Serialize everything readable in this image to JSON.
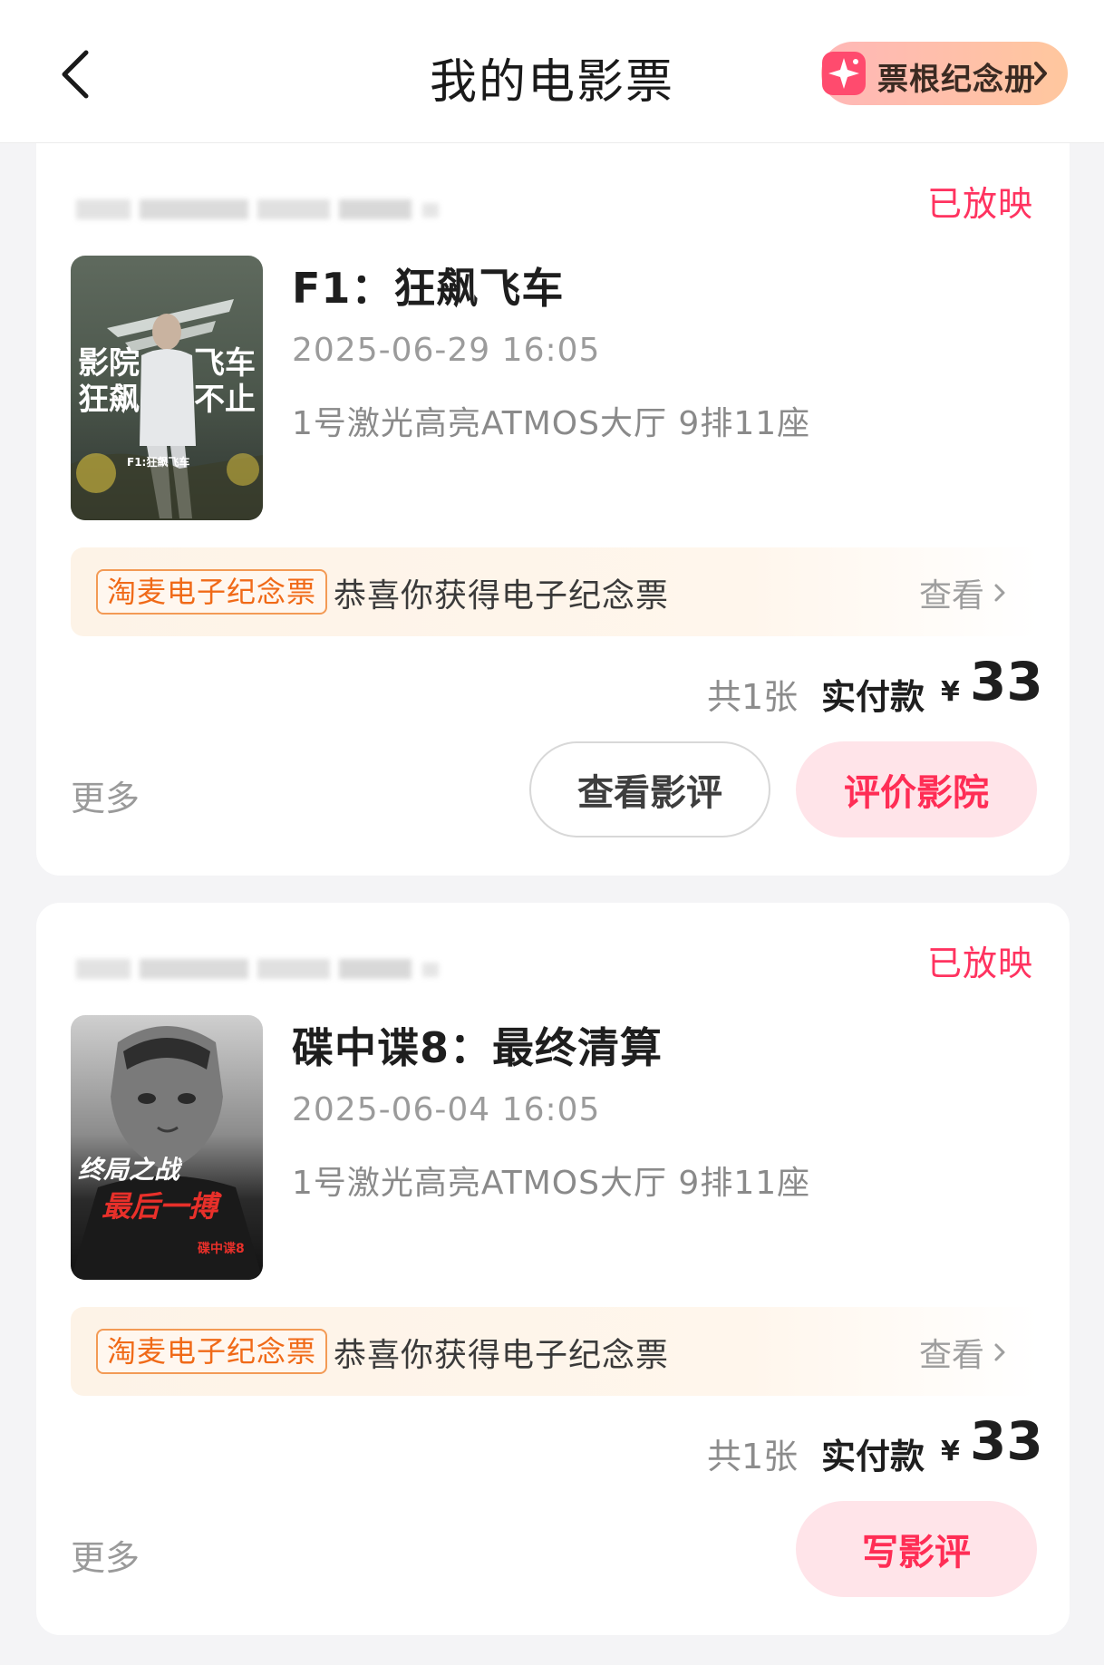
{
  "header": {
    "title": "我的电影票",
    "album_label": "票根纪念册"
  },
  "orders": [
    {
      "status": "已放映",
      "movie_title": "F1：狂飙飞车",
      "show_time": "2025-06-29 16:05",
      "seat": "1号激光高亮ATMOS大厅 9排11座",
      "souvenir_tag": "淘麦电子纪念票",
      "souvenir_text": "恭喜你获得电子纪念票",
      "souvenir_view": "查看",
      "total_count": "共1张",
      "paid_label": "实付款",
      "currency": "¥",
      "price": "33",
      "more": "更多",
      "btn_secondary": "查看影评",
      "btn_primary": "评价影院",
      "poster_text": {
        "brand": "F1",
        "line_left_1": "影院",
        "line_left_2": "狂飙",
        "line_right_1": "飞车",
        "line_right_2": "不止",
        "caption": "F1:狂飙飞车"
      }
    },
    {
      "status": "已放映",
      "movie_title": "碟中谍8：最终清算",
      "show_time": "2025-06-04 16:05",
      "seat": "1号激光高亮ATMOS大厅 9排11座",
      "souvenir_tag": "淘麦电子纪念票",
      "souvenir_text": "恭喜你获得电子纪念票",
      "souvenir_view": "查看",
      "total_count": "共1张",
      "paid_label": "实付款",
      "currency": "¥",
      "price": "33",
      "more": "更多",
      "btn_primary": "写影评",
      "poster_text": {
        "line_1": "终局之战",
        "line_2": "最后一搏",
        "caption": "碟中谍8"
      }
    }
  ],
  "colors": {
    "accent": "#ff2d55",
    "status": "#ff3360",
    "souvenir_tag": "#f06a18"
  }
}
